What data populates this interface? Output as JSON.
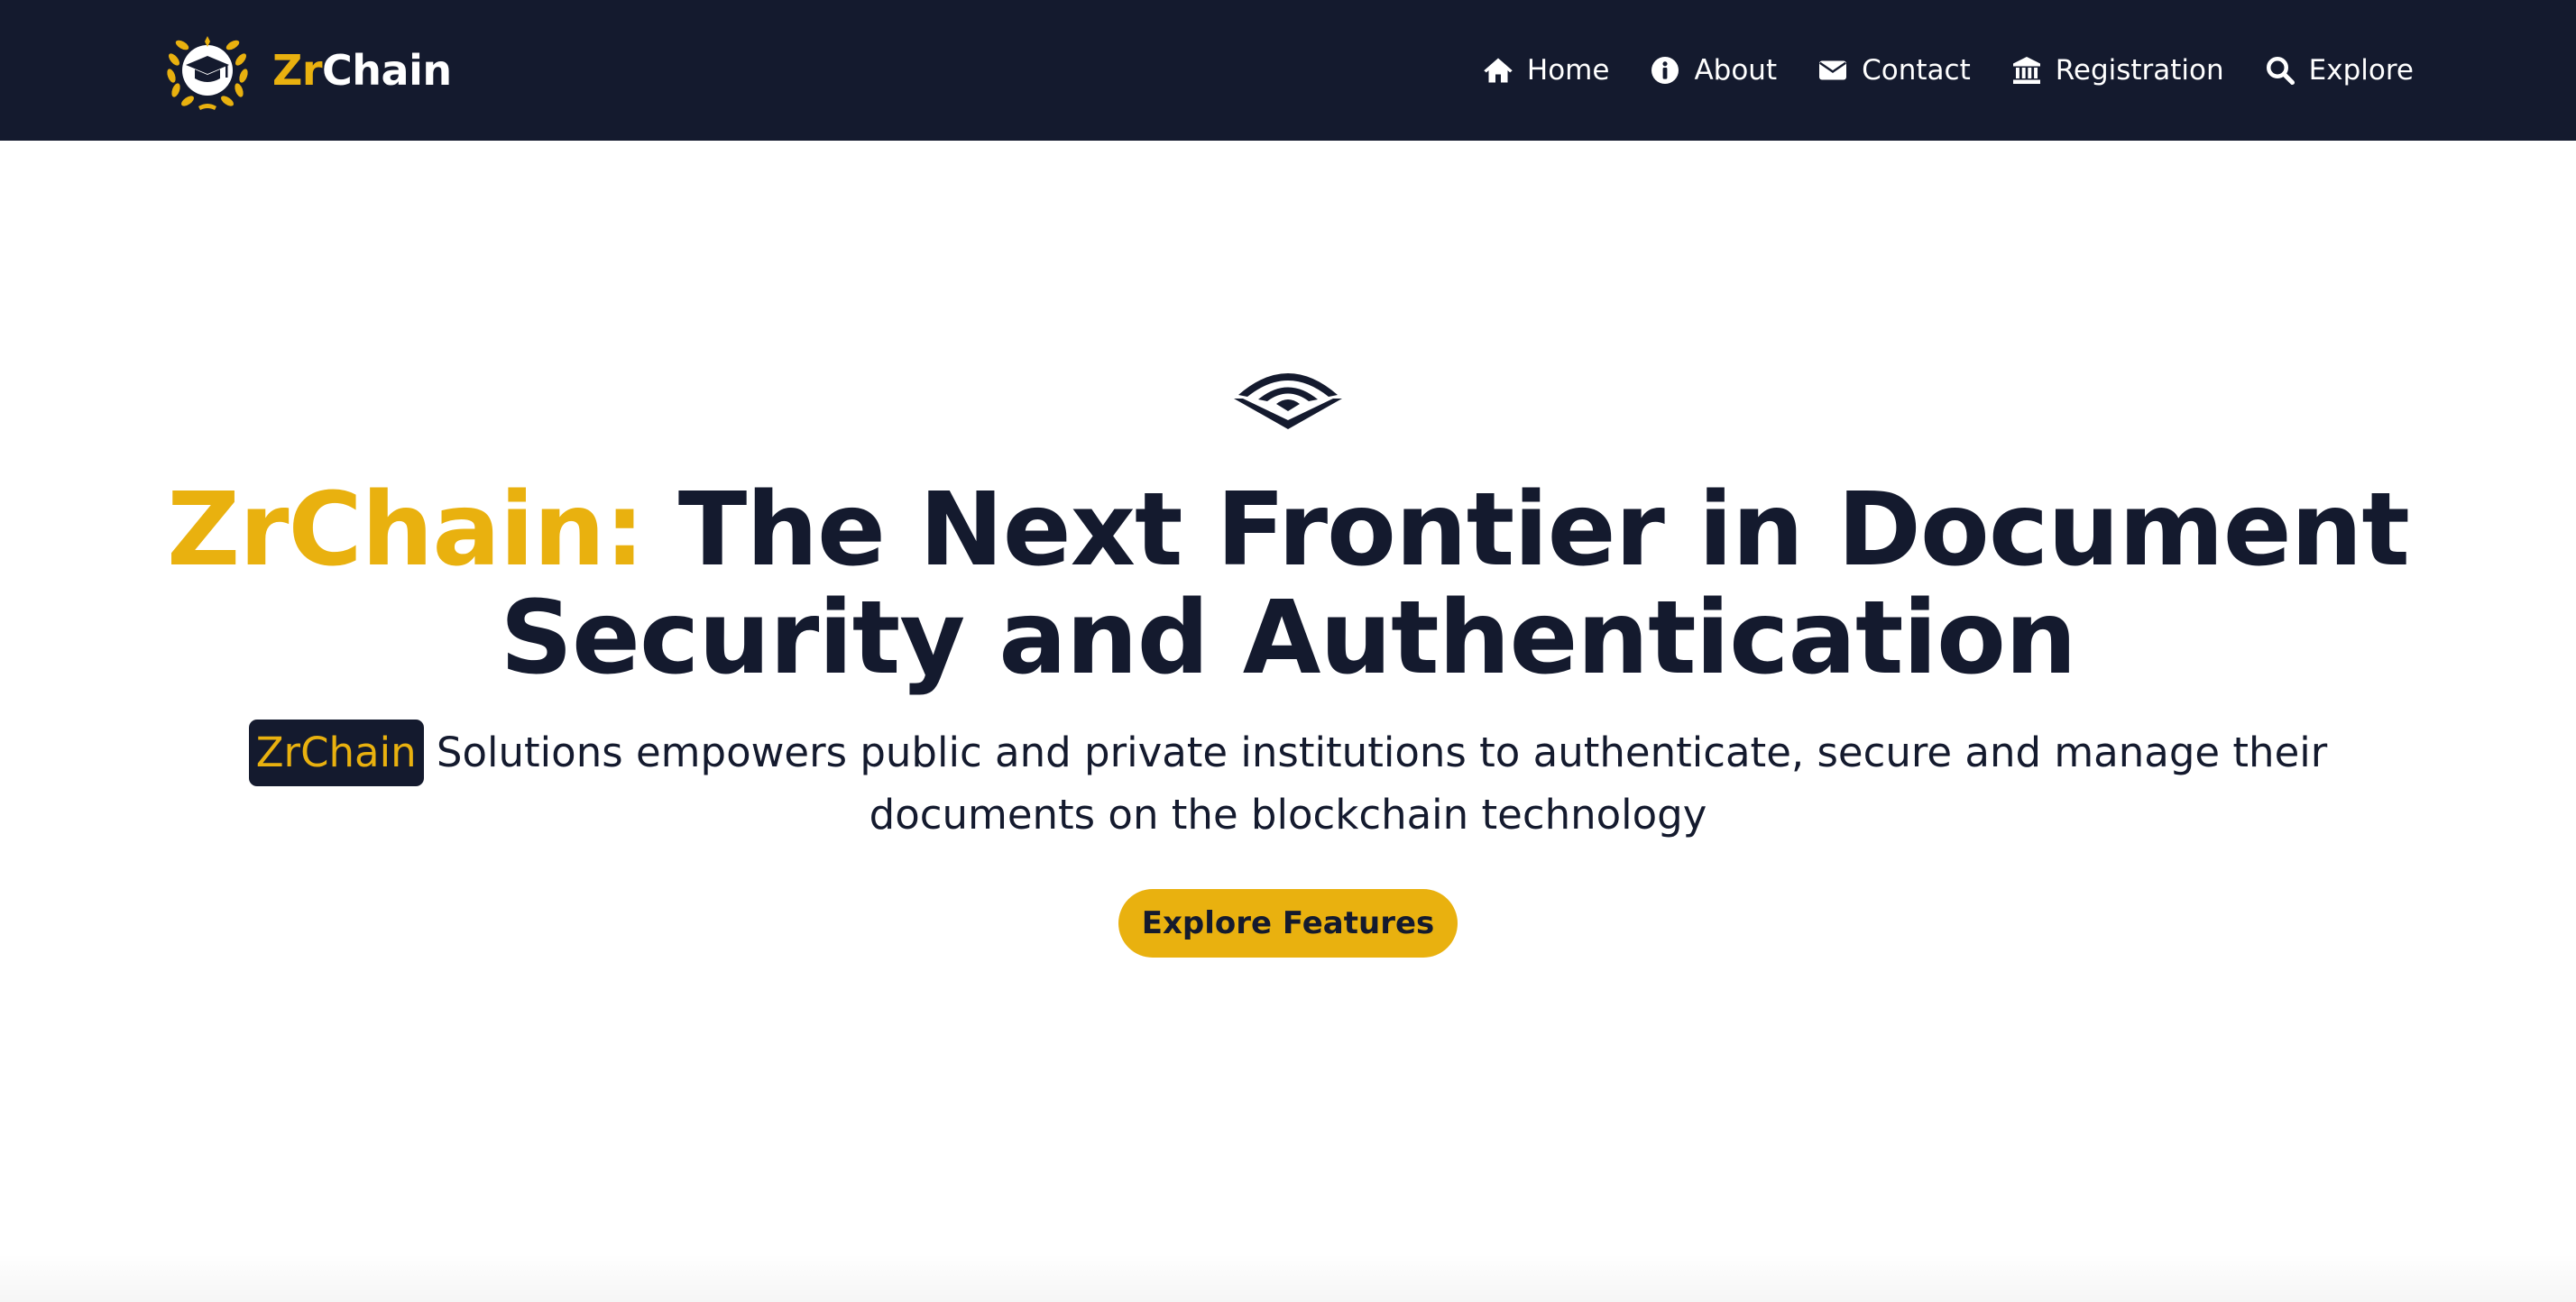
{
  "colors": {
    "navy": "#141a2e",
    "gold": "#e9b10f",
    "white": "#ffffff"
  },
  "navbar": {
    "logo_icon": "graduation-cap-laurel-icon",
    "brand_prefix": "Zr",
    "brand_suffix": "Chain",
    "links": [
      {
        "label": "Home",
        "icon": "home-icon"
      },
      {
        "label": "About",
        "icon": "info-circle-icon"
      },
      {
        "label": "Contact",
        "icon": "envelope-icon"
      },
      {
        "label": "Registration",
        "icon": "bank-icon"
      },
      {
        "label": "Explore",
        "icon": "search-icon"
      }
    ]
  },
  "hero": {
    "icon": "layered-signal-icon",
    "title_accent": "ZrChain:",
    "title_rest": " The Next Frontier in Document Security and Authentication",
    "subtitle_badge": "ZrChain",
    "subtitle_rest": " Solutions empowers public and private institutions to authenticate, secure and manage their documents on the blockchain technology",
    "cta_label": "Explore Features"
  }
}
